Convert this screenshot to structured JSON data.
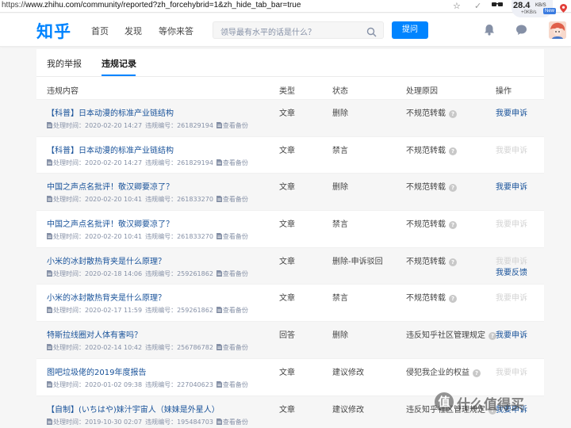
{
  "browser": {
    "url_scheme": "https://",
    "url_rest": "www.zhihu.com/community/reported?zh_forcehybrid=1&zh_hide_tab_bar=true",
    "speed_value": "28.4",
    "speed_unit": "KB/S",
    "speed_sub": "+0KB/s",
    "new_badge": "New"
  },
  "header": {
    "logo": "知乎",
    "nav": [
      "首页",
      "发现",
      "等你来答"
    ],
    "search_placeholder": "领导最有水平的话是什么？",
    "ask_button": "提问"
  },
  "tabs": {
    "reports": "我的举报",
    "violations": "违规记录"
  },
  "table": {
    "headers": {
      "content": "违规内容",
      "type": "类型",
      "status": "状态",
      "reason": "处理原因",
      "action": "操作"
    },
    "meta_labels": {
      "time": "处理时间：",
      "number": "违规编号：",
      "backup": "查看备份"
    },
    "rows": [
      {
        "title": "【科普】日本动漫的标准产业链结构",
        "time": "2020-02-20 14:27",
        "number": "261829194",
        "type": "文章",
        "status": "删除",
        "reason": "不规范转载",
        "action": "我要申诉",
        "action_disabled": false,
        "action2": ""
      },
      {
        "title": "【科普】日本动漫的标准产业链结构",
        "time": "2020-02-20 14:27",
        "number": "261829194",
        "type": "文章",
        "status": "禁言",
        "reason": "不规范转载",
        "action": "我要申诉",
        "action_disabled": true,
        "action2": ""
      },
      {
        "title": "中国之声点名批评！敬汉卿要凉了？",
        "time": "2020-02-20 10:41",
        "number": "261833270",
        "type": "文章",
        "status": "删除",
        "reason": "不规范转载",
        "action": "我要申诉",
        "action_disabled": false,
        "action2": ""
      },
      {
        "title": "中国之声点名批评！敬汉卿要凉了？",
        "time": "2020-02-20 10:41",
        "number": "261833270",
        "type": "文章",
        "status": "禁言",
        "reason": "不规范转载",
        "action": "我要申诉",
        "action_disabled": true,
        "action2": ""
      },
      {
        "title": "小米的冰封散热背夹是什么原理？",
        "time": "2020-02-18 14:06",
        "number": "259261862",
        "type": "文章",
        "status": "删除-申诉驳回",
        "reason": "不规范转载",
        "action": "我要申诉",
        "action_disabled": true,
        "action2": "我要反馈"
      },
      {
        "title": "小米的冰封散热背夹是什么原理？",
        "time": "2020-02-17 11:59",
        "number": "259261862",
        "type": "文章",
        "status": "禁言",
        "reason": "不规范转载",
        "action": "我要申诉",
        "action_disabled": true,
        "action2": ""
      },
      {
        "title": "特斯拉线圈对人体有害吗？",
        "time": "2020-02-14 10:42",
        "number": "256786782",
        "type": "回答",
        "status": "删除",
        "reason": "违反知乎社区管理规定",
        "action": "我要申诉",
        "action_disabled": false,
        "action2": ""
      },
      {
        "title": "图吧垃圾佬的2019年度报告",
        "time": "2020-01-02 09:38",
        "number": "227040623",
        "type": "文章",
        "status": "建议修改",
        "reason": "侵犯我企业的权益",
        "action": "我要申诉",
        "action_disabled": true,
        "action2": ""
      },
      {
        "title": "【自制】(いちはや)妹汁宇宙人（妹妹是外星人）",
        "time": "2019-10-30 02:07",
        "number": "195484703",
        "type": "文章",
        "status": "建议修改",
        "reason": "违反知乎社区管理规定",
        "action": "我要申诉",
        "action_disabled": false,
        "action2": ""
      }
    ]
  },
  "watermark": {
    "glyph": "值",
    "text": "什么值得买"
  },
  "colors": {
    "brand": "#0084ff",
    "link": "#175199",
    "muted": "#8590a6",
    "disabled": "#d3d3d3"
  }
}
